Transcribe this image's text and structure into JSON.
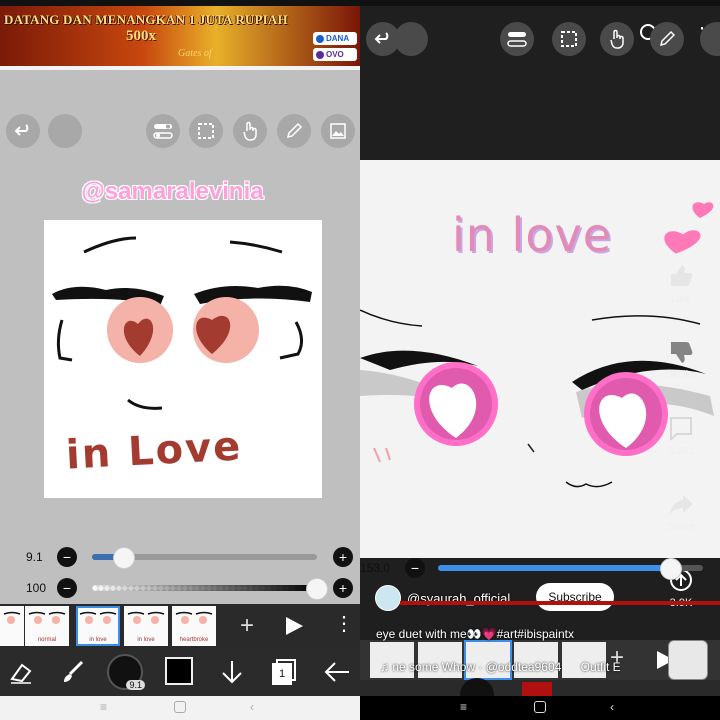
{
  "left_panel": {
    "ad_banner": {
      "headline": "DATANG DAN MENANGKAN 1 JUTA RUPIAH",
      "multiplier": "500x",
      "subtext": "Gates of",
      "pay_methods": [
        "DANA",
        "OVO"
      ]
    },
    "watermark": "@samaralevinia",
    "canvas_text": "in Love",
    "brush_size": {
      "label": "9.1",
      "value_fraction": 0.14
    },
    "opacity": {
      "label": "100",
      "value_fraction": 1.0
    },
    "frames": [
      {
        "label": ""
      },
      {
        "label": "normal"
      },
      {
        "label": "in love"
      },
      {
        "label": "in love"
      },
      {
        "label": "heartbroke"
      }
    ],
    "selected_frame": 2,
    "brush_size_badge": "9.1",
    "layer_count": "1",
    "toolbar_icons": [
      "eraser-icon",
      "brush-icon",
      "brush-size-icon",
      "color-swatch",
      "move-down-icon",
      "layers-icon",
      "back-arrow-icon"
    ],
    "colors": {
      "bg": "#bfbfbf",
      "watermark": "#ff9fdc",
      "ink": "#a33b30",
      "accent": "#3c6fb0"
    }
  },
  "right_panel": {
    "canvas_text": "in love",
    "brush_size": {
      "label": "153.0",
      "value_fraction": 0.88
    },
    "like_label": "Like",
    "dislike_label": "Dislike",
    "comment_count": "3,381",
    "share_label": "Share",
    "remix_count": "3.9K",
    "channel_name": "@syaurah_official",
    "subscribe_label": "Subscribe",
    "description": "eye duet with me👀💗#art#ibispaintx",
    "music": "ne some Whow · @oddtea9604",
    "music_next": "Outfit E",
    "colors": {
      "eye": "#ff6fc8",
      "accent": "#3c8fe8"
    }
  }
}
